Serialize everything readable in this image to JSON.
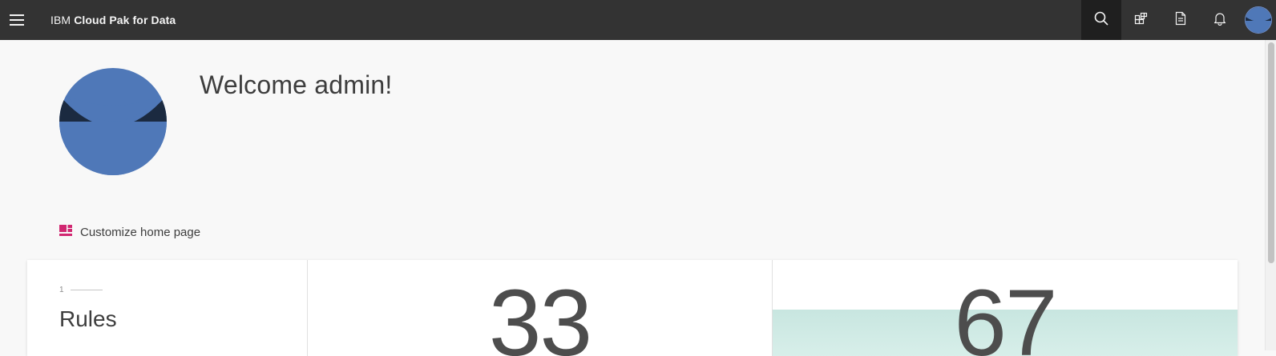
{
  "header": {
    "brand_prefix": "IBM",
    "brand_name": "Cloud Pak for Data",
    "actions": [
      {
        "icon": "search-icon"
      },
      {
        "icon": "apps-icon"
      },
      {
        "icon": "document-icon"
      },
      {
        "icon": "notification-icon"
      },
      {
        "icon": "avatar"
      }
    ]
  },
  "welcome": {
    "title": "Welcome admin!"
  },
  "customize": {
    "label": "Customize home page",
    "icon": "dashboard-icon",
    "icon_color": "#d12771"
  },
  "cards": [
    {
      "index": "1",
      "title": "Rules"
    },
    {
      "value": "33"
    },
    {
      "value": "67"
    }
  ],
  "colors": {
    "header_bg": "#333333",
    "avatar_blue": "#4f78b8",
    "avatar_dark": "#1b2a40",
    "card3_band": "#c8e6e0"
  }
}
